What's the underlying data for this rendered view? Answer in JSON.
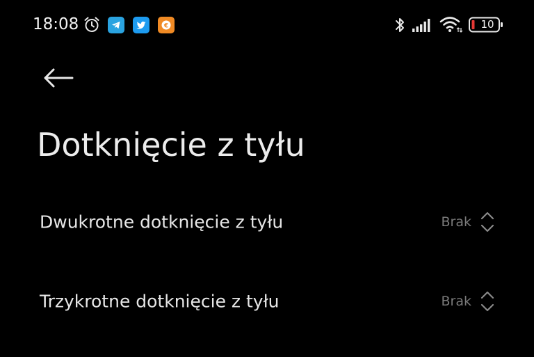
{
  "status_bar": {
    "time": "18:08",
    "battery_level": "10",
    "icons": [
      "alarm-clock-icon",
      "telegram-icon",
      "twitter-icon",
      "bitcoin-app-icon",
      "bluetooth-icon",
      "signal-icon",
      "wifi-icon",
      "battery-icon"
    ],
    "colors": {
      "telegram": "#2aa3e0",
      "twitter": "#1d9bf0",
      "bitcoin_app": "#f08a24",
      "battery_low": "#e53935"
    }
  },
  "header": {
    "back_icon": "arrow-left-icon",
    "title": "Dotknięcie z tyłu"
  },
  "settings": [
    {
      "label": "Dwukrotne dotknięcie z tyłu",
      "value": "Brak"
    },
    {
      "label": "Trzykrotne dotknięcie z tyłu",
      "value": "Brak"
    }
  ]
}
